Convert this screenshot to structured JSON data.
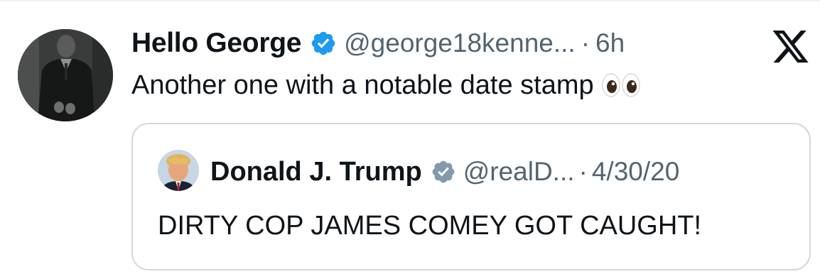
{
  "tweet": {
    "display_name": "Hello George",
    "handle": "@george18kenne...",
    "separator": "·",
    "time": "6h",
    "text": "Another one with a notable date stamp",
    "emoji": "eyes",
    "verified_color": "#1d9bf0",
    "avatar_icon": "profile-photo-man-in-dark-suit"
  },
  "quote": {
    "display_name": "Donald J. Trump",
    "handle": "@realD...",
    "separator": "·",
    "date": "4/30/20",
    "text": "DIRTY COP JAMES COMEY GOT CAUGHT!",
    "verified_color": "#829aab",
    "avatar_icon": "profile-photo-portrait"
  },
  "brand": {
    "logo_icon": "x-logo-icon",
    "text_color": "#0f1419",
    "secondary_color": "#536471",
    "border_color": "#cfd9de"
  }
}
